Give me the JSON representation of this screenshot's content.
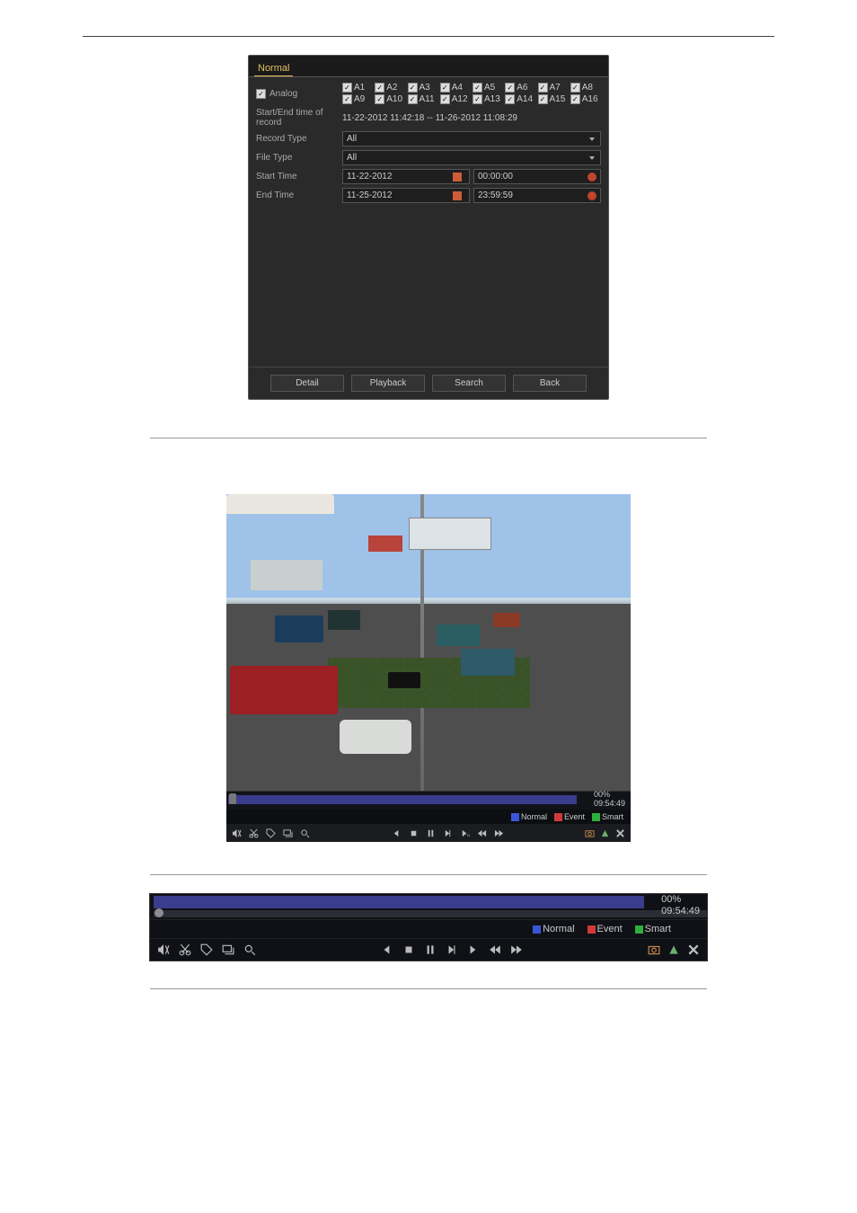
{
  "fig1": {
    "tab": "Normal",
    "analog_label": "Analog",
    "channels": [
      "A1",
      "A2",
      "A3",
      "A4",
      "A5",
      "A6",
      "A7",
      "A8",
      "A9",
      "A10",
      "A11",
      "A12",
      "A13",
      "A14",
      "A15",
      "A16"
    ],
    "startend_label": "Start/End time of record",
    "startend_value": "11-22-2012 11:42:18 -- 11-26-2012 11:08:29",
    "rectype_label": "Record Type",
    "rectype_value": "All",
    "filetype_label": "File Type",
    "filetype_value": "All",
    "starttime_label": "Start Time",
    "starttime_date": "11-22-2012",
    "starttime_time": "00:00:00",
    "endtime_label": "End Time",
    "endtime_date": "11-25-2012",
    "endtime_time": "23:59:59",
    "btn_detail": "Detail",
    "btn_playback": "Playback",
    "btn_search": "Search",
    "btn_back": "Back"
  },
  "pb": {
    "pct": "00%",
    "time": "09:54:49",
    "leg_normal": "Normal",
    "leg_event": "Event",
    "leg_smart": "Smart",
    "color_normal": "#3a56d8",
    "color_event": "#d23a3a",
    "color_smart": "#2fae3e"
  },
  "tb": {
    "pct": "00%",
    "time": "09:54:49",
    "leg_normal": "Normal",
    "leg_event": "Event",
    "leg_smart": "Smart"
  }
}
